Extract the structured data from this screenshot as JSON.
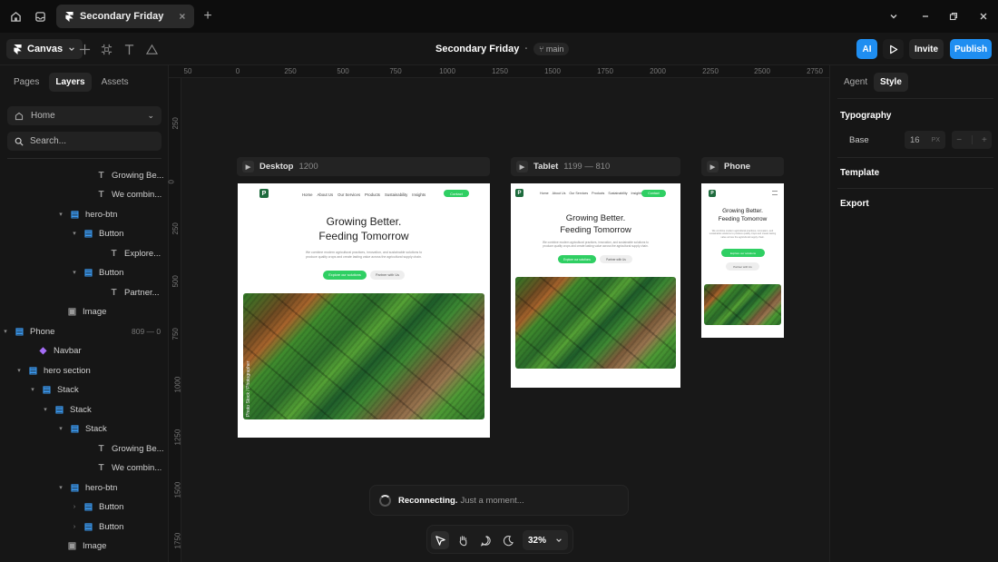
{
  "titlebar": {
    "tab_title": "Secondary Friday",
    "tab_close": "×",
    "new_tab": "+"
  },
  "toolbar": {
    "canvas_label": "Canvas",
    "doc_title": "Secondary Friday",
    "branch": "main",
    "ai_label": "AI",
    "invite_label": "Invite",
    "publish_label": "Publish"
  },
  "left_panel": {
    "tabs": [
      "Pages",
      "Layers",
      "Assets"
    ],
    "active_tab": "Layers",
    "page": "Home",
    "search_placeholder": "Search...",
    "layers": [
      {
        "label": "Growing Be...",
        "type": "text"
      },
      {
        "label": "We combin...",
        "type": "text"
      },
      {
        "label": "hero-btn",
        "type": "stack"
      },
      {
        "label": "Button",
        "type": "stack"
      },
      {
        "label": "Explore...",
        "type": "text"
      },
      {
        "label": "Button",
        "type": "stack"
      },
      {
        "label": "Partner...",
        "type": "text"
      },
      {
        "label": "Image",
        "type": "image"
      },
      {
        "label": "Phone",
        "type": "frame",
        "meta": "809 — 0"
      },
      {
        "label": "Navbar",
        "type": "component"
      },
      {
        "label": "hero section",
        "type": "stack"
      },
      {
        "label": "Stack",
        "type": "stack"
      },
      {
        "label": "Stack",
        "type": "stack"
      },
      {
        "label": "Stack",
        "type": "stack"
      },
      {
        "label": "Growing Be...",
        "type": "text"
      },
      {
        "label": "We combin...",
        "type": "text"
      },
      {
        "label": "hero-btn",
        "type": "stack"
      },
      {
        "label": "Button",
        "type": "stack"
      },
      {
        "label": "Button",
        "type": "stack"
      },
      {
        "label": "Image",
        "type": "image"
      }
    ]
  },
  "rulers": {
    "top": [
      "50",
      "0",
      "250",
      "500",
      "750",
      "1000",
      "1250",
      "1500",
      "1750",
      "2000",
      "2250",
      "2500",
      "2750"
    ],
    "left": [
      "250",
      "0",
      "250",
      "500",
      "750",
      "1000",
      "1250",
      "1500",
      "1750"
    ]
  },
  "breakpoints": {
    "desktop": {
      "name": "Desktop",
      "dims": "1200"
    },
    "tablet": {
      "name": "Tablet",
      "dims": "1199 — 810"
    },
    "phone": {
      "name": "Phone",
      "dims": ""
    }
  },
  "site": {
    "logo": "P",
    "nav": [
      "Home",
      "About Us",
      "Our Services",
      "Products",
      "Sustainability",
      "Insights"
    ],
    "contact": "Contact",
    "heading_line1": "Growing Better.",
    "heading_line2": "Feeding Tomorrow",
    "subtext": "We combine modern agricultural practices, innovation, and sustainable solutions to produce quality crops and create lasting value across the agricultural supply chain.",
    "primary_cta": "Explore our solutions",
    "secondary_cta": "Partner with Us",
    "image_credit": "Photo Stock / Photographer"
  },
  "status": {
    "title": "Reconnecting.",
    "subtitle": "Just a moment..."
  },
  "bottom_bar": {
    "zoom": "32%"
  },
  "right_panel": {
    "tabs": [
      "Agent",
      "Style"
    ],
    "active_tab": "Style",
    "typography": "Typography",
    "base_label": "Base",
    "base_value": "16",
    "base_unit": "PX",
    "template": "Template",
    "export": "Export"
  }
}
